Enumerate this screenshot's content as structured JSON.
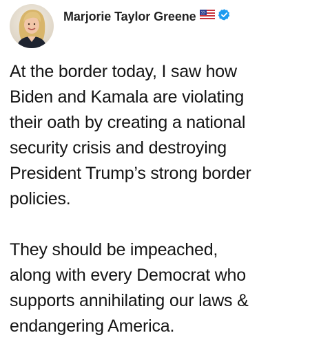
{
  "author": {
    "name": "Marjorie Taylor Greene",
    "flag_icon": "us-flag-icon",
    "verified_icon": "verified-badge-icon"
  },
  "post": {
    "paragraph1": [
      "At the border today, I saw how",
      "Biden and Kamala are violating",
      "their oath by creating a national",
      "security crisis and destroying",
      "President Trump’s strong border",
      "policies."
    ],
    "paragraph2": [
      "They should be impeached,",
      "along with every Democrat who",
      "supports annihilating our laws &",
      "endangering America."
    ]
  },
  "colors": {
    "verified_blue": "#1d9bf0",
    "text": "#141414"
  }
}
